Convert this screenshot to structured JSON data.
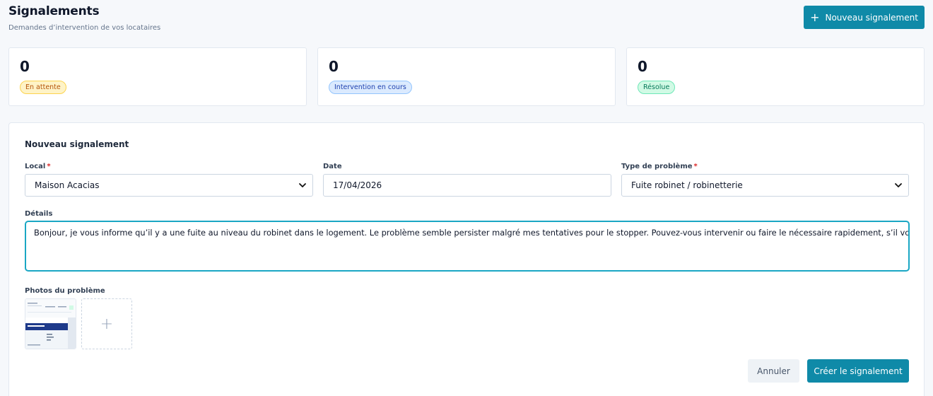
{
  "header": {
    "title": "Signalements",
    "subtitle": "Demandes d’intervention de vos locataires",
    "new_button_label": "Nouveau signalement"
  },
  "stats": [
    {
      "value": "0",
      "label": "En attente"
    },
    {
      "value": "0",
      "label": "Intervention en cours"
    },
    {
      "value": "0",
      "label": "Résolue"
    }
  ],
  "form": {
    "title": "Nouveau signalement",
    "local": {
      "label": "Local",
      "required_mark": "*",
      "value": "Maison Acacias"
    },
    "date": {
      "label": "Date",
      "value": "17/04/2026"
    },
    "problem_type": {
      "label": "Type de problème",
      "required_mark": "*",
      "value": "Fuite robinet / robinetterie"
    },
    "details": {
      "label": "Détails",
      "value": "Bonjour, je vous informe qu’il y a une fuite au niveau du robinet dans le logement. Le problème semble persister malgré mes tentatives pour le stopper. Pouvez-vous intervenir ou faire le nécessaire rapidement, s’il vous plaît ?"
    },
    "photos": {
      "label": "Photos du problème",
      "add_icon": "plus-icon"
    },
    "cancel_label": "Annuler",
    "submit_label": "Créer le signalement"
  },
  "colors": {
    "accent": "#0f8aa8",
    "focus": "#1aa7c4",
    "pending": "#b45309",
    "progress": "#1e40af",
    "resolved": "#047857"
  }
}
